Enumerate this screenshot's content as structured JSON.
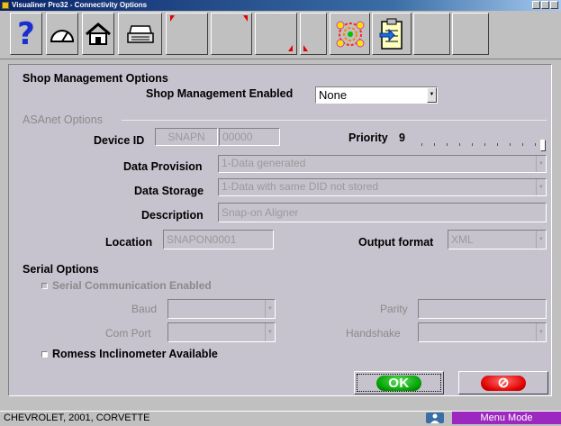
{
  "window": {
    "title": "Visualiner Pro32 - Connectivity Options"
  },
  "toolbar": {
    "buttons": [
      {
        "icon": "help-icon",
        "glyph": "?"
      },
      {
        "icon": "gauge-icon"
      },
      {
        "icon": "home-icon"
      },
      {
        "icon": "printer-icon"
      },
      {
        "icon": "blank"
      },
      {
        "icon": "blank"
      },
      {
        "icon": "blank"
      },
      {
        "icon": "blank"
      },
      {
        "icon": "network-icon"
      },
      {
        "icon": "clipboard-import-icon"
      },
      {
        "icon": "blank"
      },
      {
        "icon": "blank"
      }
    ]
  },
  "shop": {
    "section_title": "Shop Management Options",
    "enabled_label": "Shop Management Enabled",
    "enabled_value": "None"
  },
  "asanet": {
    "section_title": "ASAnet Options",
    "device_id_label": "Device ID",
    "device_id_prefix": "SNAPN",
    "device_id_number": "00000",
    "priority_label": "Priority",
    "priority_value": "9",
    "data_provision_label": "Data Provision",
    "data_provision_value": "1-Data generated",
    "data_storage_label": "Data Storage",
    "data_storage_value": "1-Data with same DID not stored",
    "description_label": "Description",
    "description_value": "Snap-on Aligner",
    "location_label": "Location",
    "location_value": "SNAPON0001",
    "output_format_label": "Output format",
    "output_format_value": "XML"
  },
  "serial": {
    "section_title": "Serial Options",
    "serial_comm_label": "Serial Communication Enabled",
    "baud_label": "Baud",
    "parity_label": "Parity",
    "com_port_label": "Com Port",
    "handshake_label": "Handshake",
    "romess_label": "Romess Inclinometer Available"
  },
  "buttons": {
    "ok_label": "OK"
  },
  "status": {
    "vehicle": "CHEVROLET, 2001, CORVETTE",
    "mode": "Menu Mode"
  },
  "colors": {
    "panel": "#c6c3ce",
    "menu_mode": "#9c28c0",
    "ok": "#00a000",
    "cancel": "#e00000"
  }
}
